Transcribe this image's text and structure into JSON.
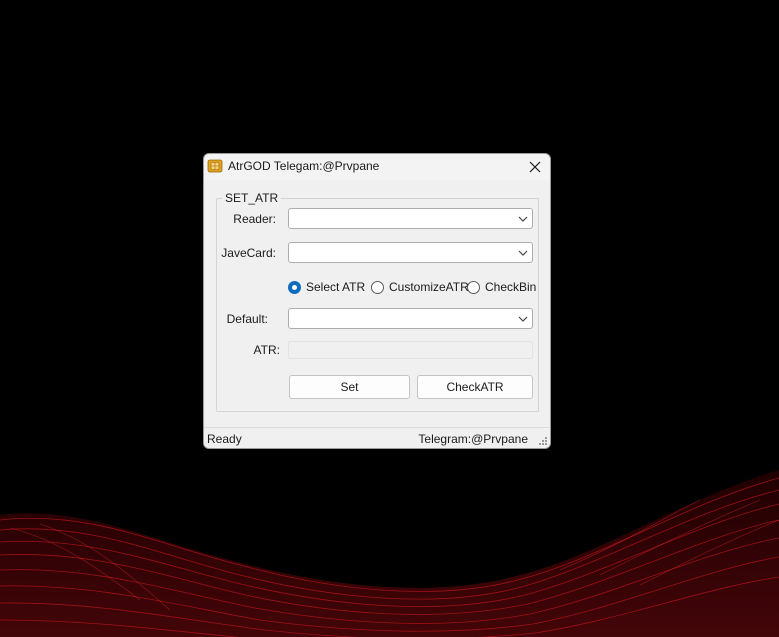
{
  "window": {
    "title": "AtrGOD Telegam:@Prvpane",
    "icon": "sim-card-icon",
    "close_icon": "close-icon"
  },
  "group": {
    "legend": "SET_ATR"
  },
  "fields": {
    "reader_label": "Reader:",
    "reader_value": "",
    "javacard_label": "JaveCard:",
    "javacard_value": "",
    "default_label": "Default:",
    "default_value": "",
    "atr_label": "ATR:",
    "atr_value": ""
  },
  "radios": {
    "options": [
      {
        "label": "Select ATR",
        "checked": true
      },
      {
        "label": "CustomizeATR",
        "checked": false
      },
      {
        "label": "CheckBin",
        "checked": false
      }
    ]
  },
  "buttons": {
    "set_label": "Set",
    "check_label": "CheckATR"
  },
  "status": {
    "left": "Ready",
    "right": "Telegram:@Prvpane"
  },
  "colors": {
    "accent": "#0f6cbd",
    "window_bg": "#f0f0f0",
    "desktop_bg": "#000000",
    "wave": "#c0141c"
  }
}
